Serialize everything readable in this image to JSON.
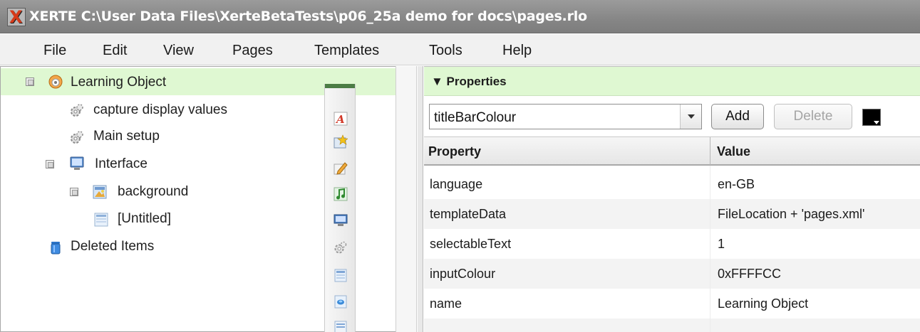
{
  "window": {
    "title": "XERTE C:\\User Data Files\\XerteBetaTests\\p06_25a demo for docs\\pages.rlo",
    "app_icon": "xerte-x-icon"
  },
  "menu": [
    "File",
    "Edit",
    "View",
    "Pages",
    "Templates",
    "Tools",
    "Help"
  ],
  "tree": [
    {
      "label": "Learning Object",
      "icon": "learning-object-icon",
      "expander": true,
      "selected": true
    },
    {
      "label": "capture display values",
      "icon": "gear-icon",
      "expander": false
    },
    {
      "label": "Main setup",
      "icon": "gear-icon",
      "expander": false
    },
    {
      "label": "Interface",
      "icon": "monitor-icon",
      "expander": true
    },
    {
      "label": "background",
      "icon": "image-page-icon",
      "expander": true
    },
    {
      "label": "[Untitled]",
      "icon": "page-icon",
      "expander": false
    },
    {
      "label": "Deleted Items",
      "icon": "trash-can-icon",
      "expander": false
    }
  ],
  "vtoolbar_icons": [
    "pdf-icon",
    "star-icon",
    "pencil-icon",
    "music-icon",
    "monitor-icon",
    "gear-icon",
    "page-icon",
    "globe-page-icon",
    "list-icon"
  ],
  "properties": {
    "header": "▼ Properties",
    "selector_value": "titleBarColour",
    "add_label": "Add",
    "delete_label": "Delete",
    "swatch_color": "#000000",
    "columns": [
      "Property",
      "Value"
    ],
    "rows": [
      {
        "property": "language",
        "value": "en-GB"
      },
      {
        "property": "templateData",
        "value": "FileLocation + 'pages.xml'"
      },
      {
        "property": "selectableText",
        "value": "1"
      },
      {
        "property": "inputColour",
        "value": "0xFFFFCC"
      },
      {
        "property": "name",
        "value": "Learning Object"
      }
    ]
  },
  "colors": {
    "selection_green": "#dff8d2",
    "title_bar_gray": "#8a8a8a",
    "toolbar_cap_green": "#4c7d45"
  }
}
